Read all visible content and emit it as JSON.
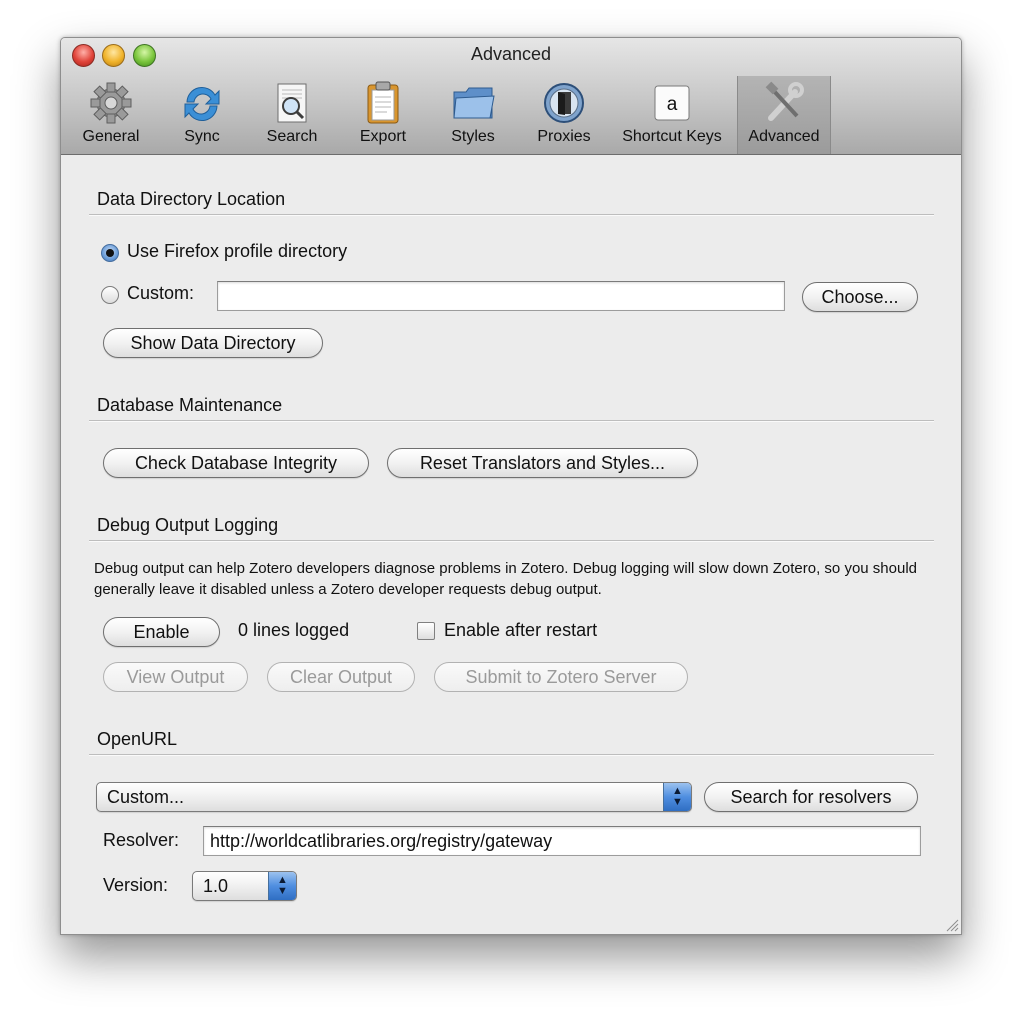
{
  "window": {
    "title": "Advanced"
  },
  "toolbar": {
    "items": [
      {
        "label": "General",
        "icon": "gear-icon"
      },
      {
        "label": "Sync",
        "icon": "sync-arrows-icon"
      },
      {
        "label": "Search",
        "icon": "magnifier-document-icon"
      },
      {
        "label": "Export",
        "icon": "clipboard-icon"
      },
      {
        "label": "Styles",
        "icon": "folder-icon"
      },
      {
        "label": "Proxies",
        "icon": "door-icon"
      },
      {
        "label": "Shortcut Keys",
        "icon": "key-a-icon",
        "key_glyph": "a"
      },
      {
        "label": "Advanced",
        "icon": "tools-icon",
        "selected": true
      }
    ]
  },
  "data_directory": {
    "title": "Data Directory Location",
    "use_profile_label": "Use Firefox profile directory",
    "custom_label": "Custom:",
    "custom_value": "",
    "choose_button": "Choose...",
    "show_button": "Show Data Directory"
  },
  "database": {
    "title": "Database Maintenance",
    "check_button": "Check Database Integrity",
    "reset_button": "Reset Translators and Styles..."
  },
  "debug": {
    "title": "Debug Output Logging",
    "description": "Debug output can help Zotero developers diagnose problems in Zotero. Debug logging will slow down Zotero, so you should generally leave it disabled unless a Zotero developer requests debug output.",
    "enable_button": "Enable",
    "lines_logged": "0 lines logged",
    "enable_after_restart": "Enable after restart",
    "view_button": "View Output",
    "clear_button": "Clear Output",
    "submit_button": "Submit to Zotero Server"
  },
  "openurl": {
    "title": "OpenURL",
    "preset_value": "Custom...",
    "search_button": "Search for resolvers",
    "resolver_label": "Resolver:",
    "resolver_value": "http://worldcatlibraries.org/registry/gateway",
    "version_label": "Version:",
    "version_value": "1.0"
  }
}
